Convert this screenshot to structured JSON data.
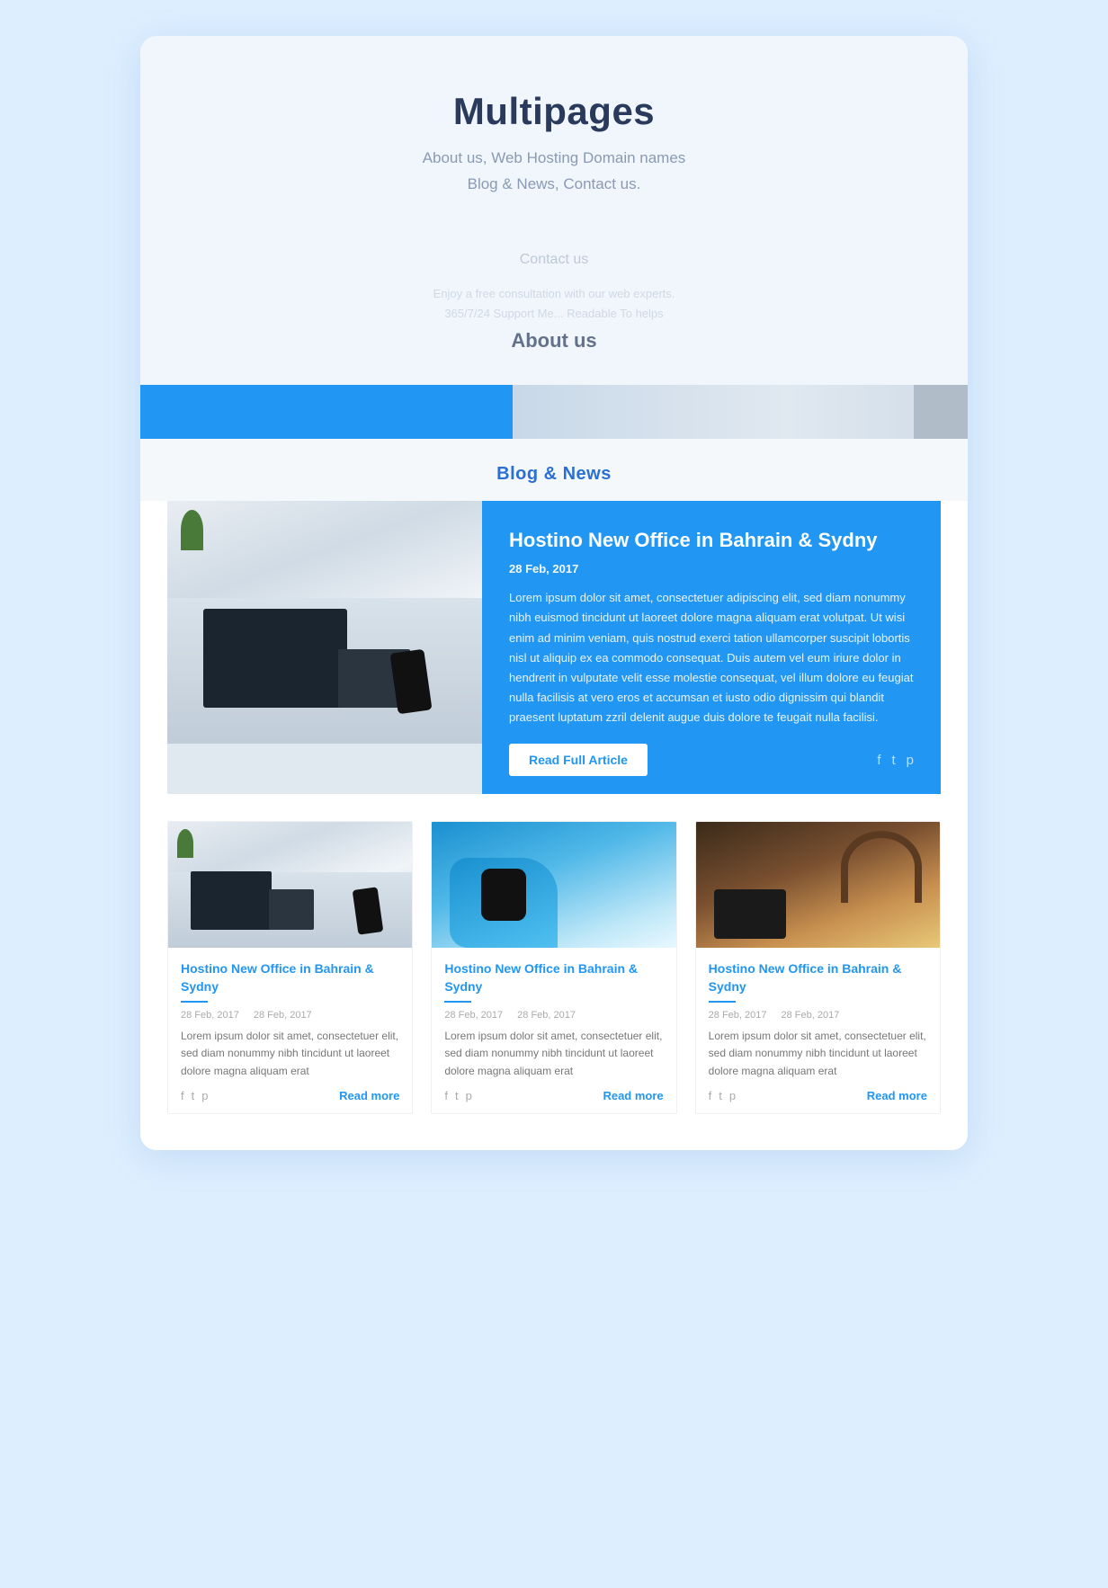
{
  "header": {
    "title": "Multipages",
    "subtitle_line1": "About us, Web Hosting Domain names",
    "subtitle_line2": "Blog & News, Contact us."
  },
  "fade_overlay": {
    "contact_label": "Contact us",
    "faded_text_line1": "Enjoy a free consultation with our web experts.",
    "faded_text_line2": "365/7/24 Support Me... Readable To helps",
    "about_label": "About us"
  },
  "blog": {
    "section_title": "Blog & News",
    "featured": {
      "title": "Hostino New Office in Bahrain & Sydny",
      "date": "28 Feb, 2017",
      "excerpt": "Lorem ipsum dolor sit amet, consectetuer adipiscing elit, sed diam nonummy nibh euismod tincidunt ut laoreet dolore magna aliquam erat volutpat. Ut wisi enim ad minim veniam, quis nostrud exerci tation ullamcorper suscipit lobortis nisl ut aliquip ex ea commodo consequat. Duis autem vel eum iriure dolor in hendrerit in vulputate velit esse molestie consequat, vel illum dolore eu feugiat nulla facilisis at vero eros et accumsan et iusto odio dignissim qui blandit praesent luptatum zzril delenit augue duis dolore te feugait nulla facilisi.",
      "read_full_label": "Read Full Article",
      "social_icons": [
        "f",
        "t",
        "p"
      ]
    },
    "cards": [
      {
        "title": "Hostino New Office in Bahrain & Sydny",
        "date1": "28 Feb, 2017",
        "date2": "28 Feb, 2017",
        "excerpt": "Lorem ipsum dolor sit amet, consectetuer elit, sed diam nonummy nibh tincidunt ut laoreet dolore magna aliquam erat",
        "read_more": "Read more",
        "social_icons": [
          "f",
          "t",
          "p"
        ]
      },
      {
        "title": "Hostino New Office in Bahrain & Sydny",
        "date1": "28 Feb, 2017",
        "date2": "28 Feb, 2017",
        "excerpt": "Lorem ipsum dolor sit amet, consectetuer elit, sed diam nonummy nibh tincidunt ut laoreet dolore magna aliquam erat",
        "read_more": "Read more",
        "social_icons": [
          "f",
          "t",
          "p"
        ]
      },
      {
        "title": "Hostino New Office in Bahrain & Sydny",
        "date1": "28 Feb, 2017",
        "date2": "28 Feb, 2017",
        "excerpt": "Lorem ipsum dolor sit amet, consectetuer elit, sed diam nonummy nibh tincidunt ut laoreet dolore magna aliquam erat",
        "read_more": "Read more",
        "social_icons": [
          "f",
          "t",
          "p"
        ]
      }
    ]
  }
}
